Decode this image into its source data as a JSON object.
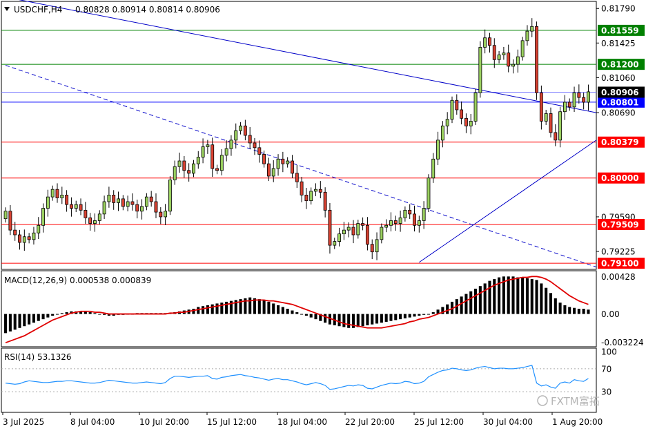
{
  "header": {
    "symbol": "USDCHF,H4",
    "ohlc": "0.80828 0.80914 0.80814 0.80906"
  },
  "macd_label": "MACD(12,26,9) 0.000538 0.000839",
  "rsi_label": "RSI(14) 53.1326",
  "watermark": "FXTM富拓",
  "colors": {
    "bull": "#9ad05f",
    "bear": "#d94232",
    "level_red": "#ff0000",
    "level_green": "#008000",
    "level_blue": "#0000ff",
    "trend_blue": "#0000c8",
    "macd_signal": "#e00000",
    "rsi_line": "#1e90ff"
  },
  "chart_data": [
    {
      "type": "candlestick",
      "panel": "price",
      "ylim": [
        0.7905,
        0.8185
      ],
      "price_ticks": [
        "0.81790",
        "0.81425",
        "0.81060",
        "0.80690",
        "0.79590",
        "0.79225"
      ],
      "x_labels": [
        "3 Jul 2025",
        "8 Jul 04:00",
        "10 Jul 20:00",
        "15 Jul 12:00",
        "18 Jul 04:00",
        "22 Jul 20:00",
        "25 Jul 12:00",
        "30 Jul 04:00",
        "1 Aug 20:00"
      ],
      "current_price": "0.80906",
      "levels": [
        {
          "label": "0.81559",
          "value": 0.81559,
          "color": "green"
        },
        {
          "label": "0.81200",
          "value": 0.812,
          "color": "green"
        },
        {
          "label": "0.80801",
          "value": 0.80801,
          "color": "blue"
        },
        {
          "label": "0.80379",
          "value": 0.80379,
          "color": "red"
        },
        {
          "label": "0.80000",
          "value": 0.8,
          "color": "red"
        },
        {
          "label": "0.79509",
          "value": 0.79509,
          "color": "red"
        },
        {
          "label": "0.79100",
          "value": 0.791,
          "color": "red"
        }
      ],
      "trendlines": [
        {
          "style": "solid",
          "from": [
            0,
            0.8191
          ],
          "to": [
            140,
            0.8069
          ]
        },
        {
          "style": "dashed",
          "from": [
            0,
            0.8119
          ],
          "to": [
            140,
            0.7906
          ]
        },
        {
          "style": "solid",
          "from": [
            88,
            0.7911
          ],
          "to": [
            140,
            0.804
          ]
        }
      ],
      "close": [
        0.7965,
        0.7945,
        0.794,
        0.7932,
        0.7938,
        0.7935,
        0.7942,
        0.795,
        0.7968,
        0.798,
        0.7988,
        0.7979,
        0.7982,
        0.7972,
        0.7968,
        0.7972,
        0.7966,
        0.7958,
        0.7952,
        0.7955,
        0.7962,
        0.7975,
        0.7982,
        0.7974,
        0.7978,
        0.797,
        0.7975,
        0.7972,
        0.7965,
        0.797,
        0.798,
        0.7975,
        0.7964,
        0.7959,
        0.7965,
        0.7998,
        0.8012,
        0.8018,
        0.8008,
        0.8005,
        0.8015,
        0.8022,
        0.8033,
        0.8035,
        0.801,
        0.8008,
        0.8024,
        0.8031,
        0.804,
        0.805,
        0.8055,
        0.8045,
        0.8037,
        0.8032,
        0.8025,
        0.8015,
        0.8002,
        0.801,
        0.802,
        0.8015,
        0.8018,
        0.8005,
        0.7996,
        0.7982,
        0.7976,
        0.7986,
        0.7988,
        0.7985,
        0.7966,
        0.7929,
        0.7933,
        0.7941,
        0.7945,
        0.7948,
        0.794,
        0.7952,
        0.795,
        0.793,
        0.7922,
        0.7935,
        0.7948,
        0.795,
        0.7955,
        0.7952,
        0.7958,
        0.7966,
        0.7962,
        0.795,
        0.7955,
        0.7968,
        0.8,
        0.802,
        0.804,
        0.8055,
        0.8062,
        0.8082,
        0.8072,
        0.8063,
        0.8055,
        0.806,
        0.809,
        0.8138,
        0.8148,
        0.814,
        0.8125,
        0.813,
        0.8132,
        0.8118,
        0.812,
        0.8128,
        0.8145,
        0.8155,
        0.816,
        0.809,
        0.806,
        0.8068,
        0.8048,
        0.804,
        0.807,
        0.808,
        0.8075,
        0.809,
        0.8085,
        0.808,
        0.8091
      ],
      "bullish": [
        true,
        false,
        false,
        false,
        true,
        false,
        true,
        true,
        true,
        true,
        true,
        false,
        true,
        false,
        false,
        true,
        false,
        false,
        false,
        true,
        true,
        true,
        true,
        false,
        true,
        false,
        true,
        false,
        false,
        true,
        true,
        false,
        false,
        false,
        true,
        true,
        true,
        true,
        false,
        false,
        true,
        true,
        true,
        true,
        false,
        false,
        true,
        true,
        true,
        true,
        true,
        false,
        false,
        false,
        false,
        false,
        false,
        true,
        true,
        false,
        true,
        false,
        false,
        false,
        false,
        true,
        true,
        false,
        false,
        false,
        true,
        true,
        true,
        true,
        false,
        true,
        false,
        false,
        false,
        true,
        true,
        true,
        true,
        false,
        true,
        true,
        false,
        false,
        true,
        true,
        true,
        true,
        true,
        true,
        true,
        true,
        false,
        false,
        false,
        true,
        true,
        true,
        true,
        false,
        false,
        true,
        true,
        false,
        true,
        true,
        true,
        true,
        true,
        false,
        false,
        true,
        false,
        false,
        true,
        true,
        false,
        true,
        false,
        false,
        true
      ]
    },
    {
      "type": "bar+line",
      "panel": "MACD",
      "name": "MACD(12,26,9)",
      "ylim": [
        -0.0036,
        0.0048
      ],
      "ticks": [
        "0.00428",
        "0.00",
        "-0.003224"
      ],
      "values": "macd_histogram",
      "signal": "macd_signal"
    },
    {
      "type": "line",
      "panel": "RSI",
      "name": "RSI(14)",
      "ylim": [
        0,
        100
      ],
      "ticks": [
        "100",
        "70",
        "30"
      ],
      "levels": [
        70,
        30
      ],
      "current": 53.1326
    }
  ],
  "macd_histogram": [
    -0.0022,
    -0.002,
    -0.0018,
    -0.0016,
    -0.0014,
    -0.0012,
    -0.001,
    -0.0008,
    -0.0006,
    -0.0004,
    -0.0002,
    0.0,
    0.0001,
    0.0002,
    0.0003,
    0.0003,
    0.0003,
    0.0003,
    0.0002,
    0.0001,
    0.0,
    -0.0001,
    -0.0002,
    -0.0002,
    -0.0001,
    -0.0001,
    0.0,
    0.0,
    0.0001,
    0.0001,
    0.0001,
    0.0001,
    0.0001,
    0.0001,
    0.0001,
    0.0001,
    0.0002,
    0.0003,
    0.0004,
    0.0005,
    0.0006,
    0.0008,
    0.0009,
    0.001,
    0.0011,
    0.0012,
    0.0013,
    0.0014,
    0.0015,
    0.0016,
    0.0017,
    0.0018,
    0.0019,
    0.0018,
    0.0017,
    0.0016,
    0.0014,
    0.0012,
    0.001,
    0.0008,
    0.0006,
    0.0004,
    0.0002,
    0.0,
    -0.0002,
    -0.0004,
    -0.0006,
    -0.0008,
    -0.001,
    -0.0012,
    -0.0013,
    -0.0014,
    -0.0015,
    -0.0016,
    -0.0016,
    -0.0015,
    -0.0014,
    -0.0013,
    -0.0012,
    -0.0011,
    -0.001,
    -0.0009,
    -0.0008,
    -0.0007,
    -0.0006,
    -0.0005,
    -0.0004,
    -0.0003,
    -0.0002,
    -0.0001,
    0.0,
    0.0002,
    0.0005,
    0.0008,
    0.0011,
    0.0014,
    0.0017,
    0.002,
    0.0023,
    0.0026,
    0.0029,
    0.0032,
    0.0035,
    0.0038,
    0.004,
    0.0042,
    0.0043,
    0.0043,
    0.0043,
    0.0042,
    0.0042,
    0.0041,
    0.004,
    0.0039,
    0.0035,
    0.003,
    0.0024,
    0.0018,
    0.0013,
    0.001,
    0.0008,
    0.0007,
    0.0006,
    0.0006,
    0.0005
  ],
  "macd_signal": [
    -0.0033,
    -0.0031,
    -0.0029,
    -0.0027,
    -0.0025,
    -0.0022,
    -0.0019,
    -0.0016,
    -0.0013,
    -0.001,
    -0.0007,
    -0.0005,
    -0.0003,
    -0.0001,
    0.0001,
    0.0002,
    0.0003,
    0.0003,
    0.0003,
    0.0002,
    0.0002,
    0.0001,
    0.0,
    0.0,
    0.0,
    0.0,
    0.0,
    0.0,
    0.0,
    0.0,
    0.0,
    0.0,
    0.0,
    0.0,
    0.0,
    0.0001,
    0.0001,
    0.0002,
    0.0002,
    0.0003,
    0.0004,
    0.0005,
    0.0006,
    0.0007,
    0.0008,
    0.0009,
    0.001,
    0.0011,
    0.0012,
    0.0013,
    0.0014,
    0.0015,
    0.0015,
    0.0016,
    0.0016,
    0.0016,
    0.0015,
    0.0015,
    0.0014,
    0.0013,
    0.0012,
    0.0011,
    0.0009,
    0.0007,
    0.0005,
    0.0003,
    0.0001,
    -0.0001,
    -0.0003,
    -0.0005,
    -0.0007,
    -0.0009,
    -0.0011,
    -0.0012,
    -0.0013,
    -0.0014,
    -0.0015,
    -0.0016,
    -0.0016,
    -0.0016,
    -0.0016,
    -0.0015,
    -0.0014,
    -0.0013,
    -0.0012,
    -0.0011,
    -0.0009,
    -0.0008,
    -0.0006,
    -0.0005,
    -0.0004,
    -0.0002,
    0.0,
    0.0002,
    0.0004,
    0.0006,
    0.0009,
    0.0012,
    0.0015,
    0.0018,
    0.0021,
    0.0024,
    0.0027,
    0.003,
    0.0033,
    0.0035,
    0.0037,
    0.0039,
    0.004,
    0.0041,
    0.0042,
    0.0042,
    0.0043,
    0.0043,
    0.0042,
    0.004,
    0.0037,
    0.0033,
    0.0029,
    0.0025,
    0.0021,
    0.0018,
    0.0015,
    0.0013,
    0.0011
  ],
  "rsi_values": [
    45,
    44,
    43,
    44,
    47,
    49,
    48,
    47,
    46,
    46,
    47,
    48,
    48,
    49,
    49,
    48,
    47,
    46,
    45,
    45,
    46,
    48,
    50,
    49,
    48,
    47,
    46,
    45,
    45,
    46,
    47,
    46,
    45,
    44,
    46,
    53,
    57,
    57,
    56,
    55,
    56,
    57,
    57,
    58,
    53,
    52,
    55,
    56,
    58,
    59,
    60,
    58,
    57,
    55,
    54,
    52,
    50,
    52,
    53,
    51,
    51,
    49,
    47,
    44,
    42,
    44,
    46,
    44,
    41,
    34,
    35,
    37,
    39,
    41,
    40,
    42,
    41,
    36,
    35,
    38,
    41,
    43,
    45,
    44,
    45,
    48,
    47,
    44,
    45,
    48,
    56,
    60,
    64,
    67,
    68,
    71,
    70,
    68,
    67,
    68,
    71,
    73,
    74,
    72,
    70,
    71,
    71,
    70,
    70,
    71,
    72,
    74,
    76,
    45,
    40,
    42,
    38,
    36,
    45,
    47,
    45,
    51,
    49,
    48,
    53
  ]
}
